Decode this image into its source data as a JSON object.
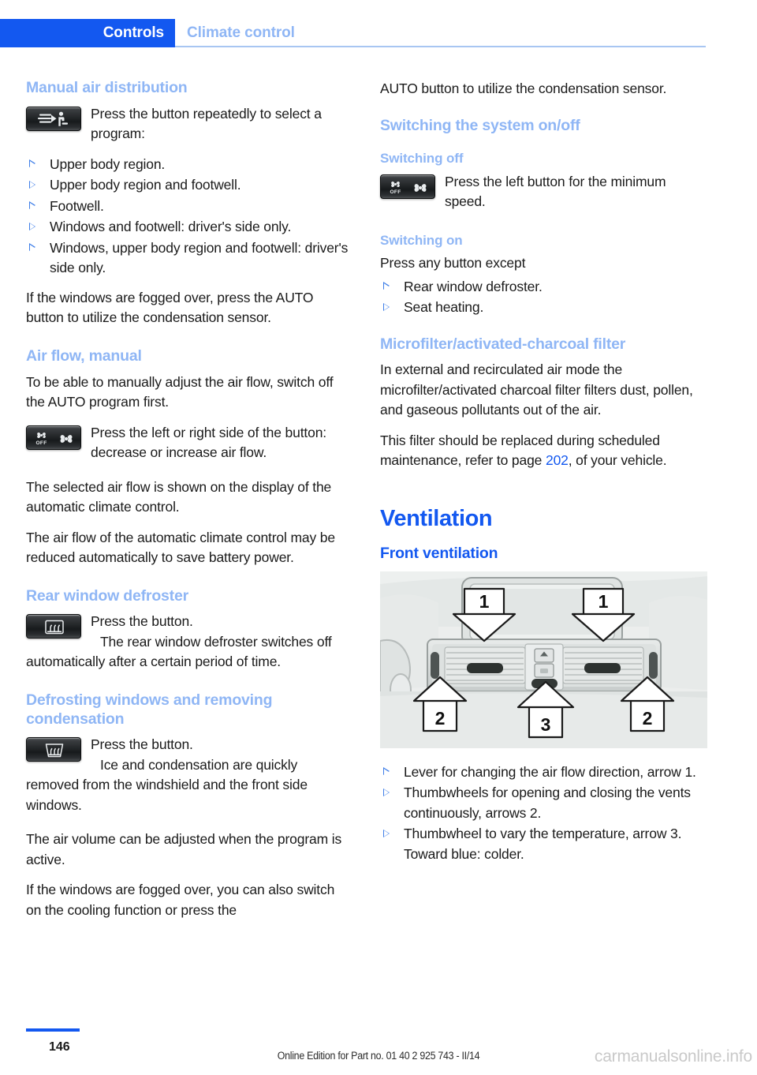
{
  "header": {
    "active_tab": "Controls",
    "breadcrumb": "Climate control"
  },
  "left_column": {
    "manual_air_distribution": {
      "heading": "Manual air distribution",
      "icon": "air-distribution-button-icon",
      "intro": "Press the button repeatedly to select a program:",
      "programs": [
        "Upper body region.",
        "Upper body region and footwell.",
        "Footwell.",
        "Windows and footwell: driver's side only.",
        "Windows, upper body region and footwell: driver's side only."
      ],
      "note": "If the windows are fogged over, press the AUTO button to utilize the condensation sensor."
    },
    "air_flow_manual": {
      "heading": "Air flow, manual",
      "intro": "To be able to manually adjust the air flow, switch off the AUTO program first.",
      "icon": "fan-off-button-icon",
      "icon_text": "Press the left or right side of the button: decrease or increase air flow.",
      "para_1": "The selected air flow is shown on the display of the automatic climate control.",
      "para_2": "The air flow of the automatic climate control may be reduced automatically to save battery power."
    },
    "rear_window_defroster": {
      "heading": "Rear window defroster",
      "icon": "rear-defroster-button-icon",
      "line_1": "Press the button.",
      "line_2": "The rear window defroster switches off automatically after a certain period of time."
    },
    "defrosting_windows": {
      "heading": "Defrosting windows and removing condensation",
      "icon": "windshield-defroster-button-icon",
      "line_1": "Press the button.",
      "line_2": "Ice and condensation are quickly removed from the windshield and the front side windows.",
      "para_1": "The air volume can be adjusted when the program is active.",
      "para_2": "If the windows are fogged over, you can also switch on the cooling function or press the"
    }
  },
  "right_column": {
    "continuation": "AUTO button to utilize the condensation sensor.",
    "switching_system": {
      "heading": "Switching the system on/off",
      "off": {
        "subheading": "Switching off",
        "icon": "fan-off-button-icon",
        "text": "Press the left button for the minimum speed."
      },
      "on": {
        "subheading": "Switching on",
        "intro": "Press any button except",
        "items": [
          "Rear window defroster.",
          "Seat heating."
        ]
      }
    },
    "microfilter": {
      "heading": "Microfilter/activated-charcoal filter",
      "para_1": "In external and recirculated air mode the microfilter/activated charcoal filter filters dust, pollen, and gaseous pollutants out of the air.",
      "para_2_before": "This filter should be replaced during scheduled maintenance, refer to page ",
      "page_link": "202",
      "para_2_after": ", of your vehicle."
    },
    "ventilation": {
      "chapter": "Ventilation",
      "subsection": "Front ventilation",
      "figure": {
        "name": "front-ventilation-diagram",
        "callouts": [
          "1",
          "1",
          "2",
          "3",
          "2"
        ]
      },
      "items": [
        "Lever for changing the air flow direction, arrow 1.",
        "Thumbwheels for opening and closing the vents continuously, arrows 2.",
        "Thumbwheel to vary the temperature, arrow 3."
      ],
      "extra_line": "Toward blue: colder."
    }
  },
  "footer": {
    "page_number": "146",
    "edition": "Online Edition for Part no. 01 40 2 925 743 - II/14",
    "watermark": "carmanualsonline.info"
  },
  "colors": {
    "accent_blue": "#1358f0",
    "light_blue": "#8fb6f5",
    "rule_blue": "#a8c6f2"
  }
}
